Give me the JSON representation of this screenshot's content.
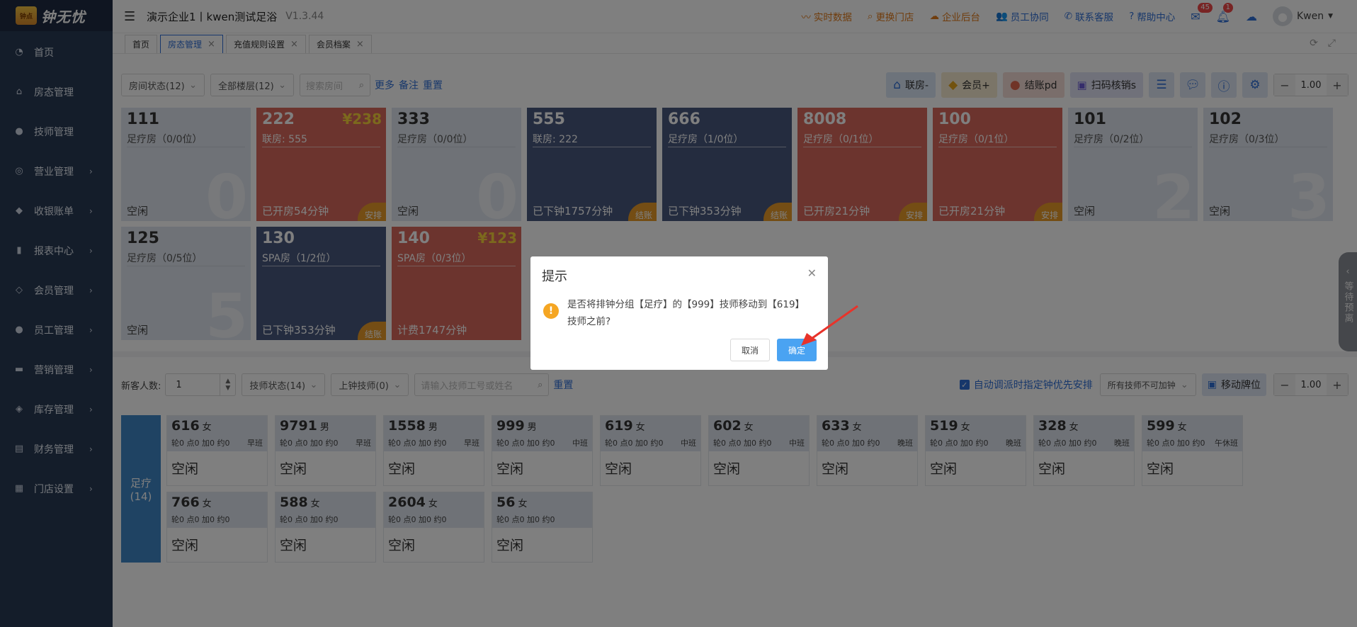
{
  "sidebar": {
    "logo_mark": "钟点",
    "logo_text": "钟无忧",
    "items": [
      {
        "label": "首页",
        "icon": "dashboard-icon",
        "glyph": "◔",
        "chevron": false
      },
      {
        "label": "房态管理",
        "icon": "home-icon",
        "glyph": "⌂",
        "chevron": false
      },
      {
        "label": "技师管理",
        "icon": "person-icon",
        "glyph": "●",
        "chevron": false
      },
      {
        "label": "营业管理",
        "icon": "target-icon",
        "glyph": "◎",
        "chevron": true
      },
      {
        "label": "收银账单",
        "icon": "money-bag-icon",
        "glyph": "◆",
        "chevron": true
      },
      {
        "label": "报表中心",
        "icon": "bar-chart-icon",
        "glyph": "▮",
        "chevron": true
      },
      {
        "label": "会员管理",
        "icon": "diamond-icon",
        "glyph": "◇",
        "chevron": true
      },
      {
        "label": "员工管理",
        "icon": "person-icon",
        "glyph": "●",
        "chevron": true
      },
      {
        "label": "营销管理",
        "icon": "briefcase-icon",
        "glyph": "▬",
        "chevron": true
      },
      {
        "label": "库存管理",
        "icon": "cube-icon",
        "glyph": "◈",
        "chevron": true
      },
      {
        "label": "财务管理",
        "icon": "wallet-icon",
        "glyph": "▤",
        "chevron": true
      },
      {
        "label": "门店设置",
        "icon": "grid-icon",
        "glyph": "▦",
        "chevron": true
      }
    ]
  },
  "header": {
    "company": "演示企业1丨kwen测试足浴",
    "version": "V1.3.44",
    "links": [
      {
        "label": "实时数据",
        "icon": "pulse-icon",
        "glyph": "〰",
        "color": "orange"
      },
      {
        "label": "更换门店",
        "icon": "search-icon",
        "glyph": "⌕",
        "color": "orange"
      },
      {
        "label": "企业后台",
        "icon": "cloud-icon",
        "glyph": "☁",
        "color": "orange"
      },
      {
        "label": "员工协同",
        "icon": "people-icon",
        "glyph": "👥",
        "color": "blue"
      },
      {
        "label": "联系客服",
        "icon": "phone-icon",
        "glyph": "✆",
        "color": "blue"
      },
      {
        "label": "帮助中心",
        "icon": "question-icon",
        "glyph": "?",
        "color": "blue"
      }
    ],
    "mail_badge": "45",
    "bell_badge": "1",
    "user": "Kwen"
  },
  "tabs": [
    {
      "label": "首页",
      "active": false,
      "closable": false
    },
    {
      "label": "房态管理",
      "active": true,
      "closable": true
    },
    {
      "label": "充值规则设置",
      "active": false,
      "closable": true
    },
    {
      "label": "会员档案",
      "active": false,
      "closable": true
    }
  ],
  "room_toolbar": {
    "room_status": "房间状态(12)",
    "floor": "全部楼层(12)",
    "search_placeholder": "搜索房间",
    "more": "更多",
    "note": "备注",
    "reset": "重置",
    "actions": {
      "lianfang": "联房-",
      "member": "会员+",
      "checkout": "结账pd",
      "scan": "扫码核销s"
    },
    "zoom": "1.00"
  },
  "rooms": [
    {
      "num": "111",
      "sub": "足疗房（0/0位）",
      "status": "空闲",
      "theme": "idle",
      "big": "0",
      "price": "",
      "corner": ""
    },
    {
      "num": "222",
      "sub": "联房:  555",
      "status": "已开房54分钟",
      "theme": "red",
      "big": "",
      "price": "¥238",
      "corner": "安排"
    },
    {
      "num": "333",
      "sub": "足疗房（0/0位）",
      "status": "空闲",
      "theme": "idle",
      "big": "0",
      "price": "",
      "corner": ""
    },
    {
      "num": "555",
      "sub": "联房:  222",
      "status": "已下钟1757分钟",
      "theme": "navy",
      "big": "",
      "price": "",
      "corner": "结账"
    },
    {
      "num": "666",
      "sub": "足疗房（1/0位）",
      "status": "已下钟353分钟",
      "theme": "navy",
      "big": "",
      "price": "",
      "corner": "结账"
    },
    {
      "num": "8008",
      "sub": "足疗房（0/1位）",
      "status": "已开房21分钟",
      "theme": "red",
      "big": "",
      "price": "",
      "corner": "安排"
    },
    {
      "num": "100",
      "sub": "足疗房（0/1位）",
      "status": "已开房21分钟",
      "theme": "red",
      "big": "",
      "price": "",
      "corner": "安排"
    },
    {
      "num": "101",
      "sub": "足疗房（0/2位）",
      "status": "空闲",
      "theme": "idle",
      "big": "2",
      "price": "",
      "corner": ""
    },
    {
      "num": "102",
      "sub": "足疗房（0/3位）",
      "status": "空闲",
      "theme": "idle",
      "big": "3",
      "price": "",
      "corner": ""
    },
    {
      "num": "125",
      "sub": "足疗房（0/5位）",
      "status": "空闲",
      "theme": "idle",
      "big": "5",
      "price": "",
      "corner": ""
    },
    {
      "num": "130",
      "sub": "SPA房（1/2位）",
      "status": "已下钟353分钟",
      "theme": "navy",
      "big": "",
      "price": "",
      "corner": "结账"
    },
    {
      "num": "140",
      "sub": "SPA房（0/3位）",
      "status": "计费1747分钟",
      "theme": "red",
      "big": "",
      "price": "¥123",
      "corner": ""
    }
  ],
  "tech_toolbar": {
    "new_guest_label": "新客人数:",
    "new_guest_value": "1",
    "tech_status": "技师状态(14)",
    "on_clock": "上钟技师(0)",
    "search_placeholder": "请输入技师工号或姓名",
    "reset": "重置",
    "auto_dispatch": "自动调派时指定钟优先安排",
    "all_tech_select": "所有技师不可加钟",
    "move_label": "移动牌位",
    "zoom": "1.00"
  },
  "group": {
    "name": "足疗",
    "count": "(14)"
  },
  "techs": [
    {
      "num": "616",
      "sex": "女",
      "stats": "轮0 点0 加0 约0",
      "shift": "早班",
      "status": "空闲"
    },
    {
      "num": "9791",
      "sex": "男",
      "stats": "轮0 点0 加0 约0",
      "shift": "早班",
      "status": "空闲"
    },
    {
      "num": "1558",
      "sex": "男",
      "stats": "轮0 点0 加0 约0",
      "shift": "早班",
      "status": "空闲"
    },
    {
      "num": "999",
      "sex": "男",
      "stats": "轮0 点0 加0 约0",
      "shift": "中班",
      "status": "空闲"
    },
    {
      "num": "619",
      "sex": "女",
      "stats": "轮0 点0 加0 约0",
      "shift": "中班",
      "status": "空闲"
    },
    {
      "num": "602",
      "sex": "女",
      "stats": "轮0 点0 加0 约0",
      "shift": "中班",
      "status": "空闲"
    },
    {
      "num": "633",
      "sex": "女",
      "stats": "轮0 点0 加0 约0",
      "shift": "晚班",
      "status": "空闲"
    },
    {
      "num": "519",
      "sex": "女",
      "stats": "轮0 点0 加0 约0",
      "shift": "晚班",
      "status": "空闲"
    },
    {
      "num": "328",
      "sex": "女",
      "stats": "轮0 点0 加0 约0",
      "shift": "晚班",
      "status": "空闲"
    },
    {
      "num": "599",
      "sex": "女",
      "stats": "轮0 点0 加0 约0",
      "shift": "午休班",
      "status": "空闲"
    },
    {
      "num": "766",
      "sex": "女",
      "stats": "轮0 点0 加0 约0",
      "shift": "",
      "status": "空闲"
    },
    {
      "num": "588",
      "sex": "女",
      "stats": "轮0 点0 加0 约0",
      "shift": "",
      "status": "空闲"
    },
    {
      "num": "2604",
      "sex": "女",
      "stats": "轮0 点0 加0 约0",
      "shift": "",
      "status": "空闲"
    },
    {
      "num": "56",
      "sex": "女",
      "stats": "轮0 点0 加0 约0",
      "shift": "",
      "status": "空闲"
    }
  ],
  "side_tab": {
    "text": "等待预离"
  },
  "modal": {
    "title": "提示",
    "message": "是否将排钟分组【足疗】的【999】技师移动到【619】技师之前?",
    "cancel": "取消",
    "ok": "确定"
  },
  "colors": {
    "sidebar": "#293a55",
    "accent": "#2f6fd6",
    "room_red": "#d9695c",
    "room_navy": "#49587e",
    "room_idle": "#dfe5ee",
    "ok_button": "#4aa3f2",
    "arrow": "#e8332a"
  }
}
